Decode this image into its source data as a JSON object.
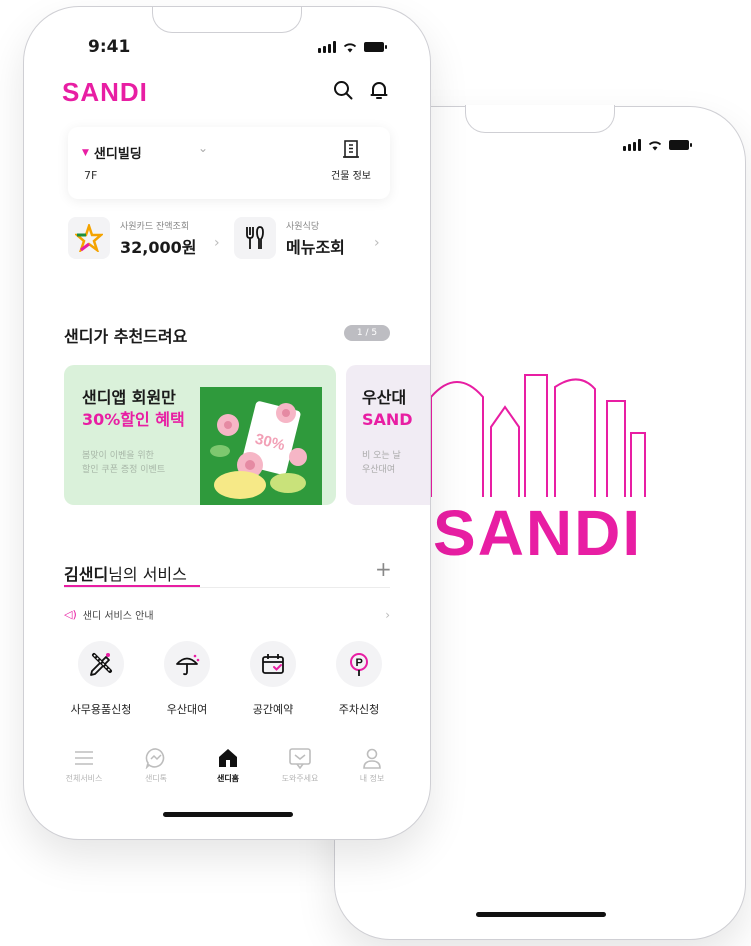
{
  "colors": {
    "accent": "#e81ea3",
    "banner_green": "#daf1da",
    "art_green": "#2f9a3c"
  },
  "status_bar": {
    "time": "9:41"
  },
  "header": {
    "logo": "SANDI",
    "icons": [
      "search-icon",
      "bell-icon"
    ]
  },
  "building": {
    "name": "샌디빌딩",
    "floor": "7F",
    "info_label": "건물 정보"
  },
  "quick_cards": [
    {
      "subtitle": "사원카드 잔액조회",
      "value": "32,000원"
    },
    {
      "subtitle": "사원식당",
      "value": "메뉴조회"
    }
  ],
  "recommend": {
    "title": "샌디가 추천드려요",
    "pager": "1 / 5",
    "banners": [
      {
        "title_line1": "샌디앱 회원만",
        "title_line2": "30%할인 혜택",
        "desc_line1": "봄맞이 이벤을 위한",
        "desc_line2": "할인 쿠폰 증정 이벤트",
        "art_badge": "30%"
      },
      {
        "title_line1": "우산대",
        "title_line2": "SAND",
        "desc_line1": "비 오는 날",
        "desc_line2": "우산대여"
      }
    ]
  },
  "services": {
    "title_name": "김샌디",
    "title_suffix": "님의 서비스",
    "notice": "샌디 서비스 안내",
    "items": [
      {
        "label": "사무용품신청",
        "icon": "pencil-ruler-icon"
      },
      {
        "label": "우산대여",
        "icon": "umbrella-icon"
      },
      {
        "label": "공간예약",
        "icon": "calendar-check-icon"
      },
      {
        "label": "주차신청",
        "icon": "parking-icon"
      }
    ]
  },
  "tabbar": {
    "active": 2,
    "items": [
      {
        "label": "전체서비스",
        "icon": "menu-icon"
      },
      {
        "label": "샌디톡",
        "icon": "chat-icon"
      },
      {
        "label": "샌디홈",
        "icon": "home-icon"
      },
      {
        "label": "도와주세요",
        "icon": "help-icon"
      },
      {
        "label": "내 정보",
        "icon": "user-icon"
      }
    ]
  },
  "splash": {
    "logo": "SANDI"
  }
}
